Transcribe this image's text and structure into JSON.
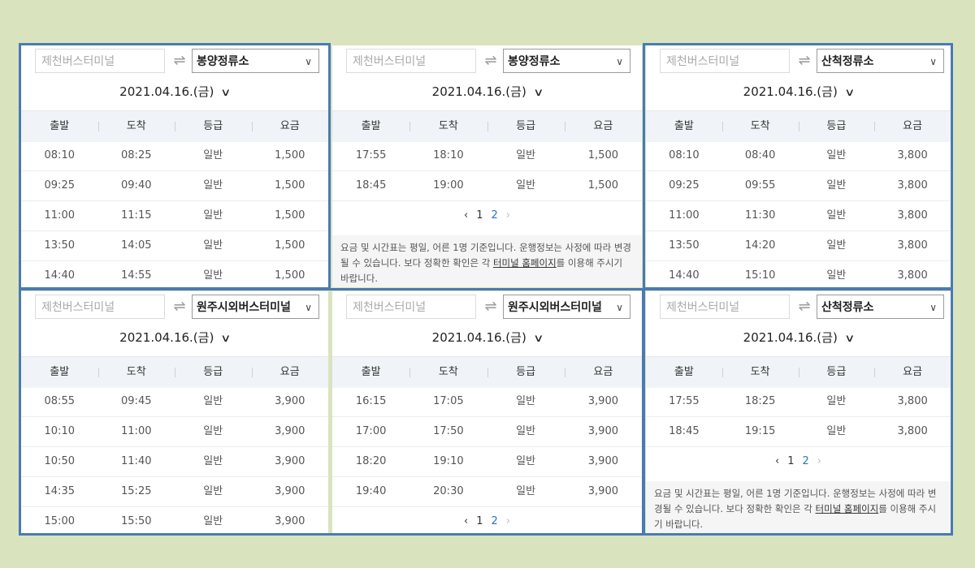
{
  "headers": [
    "출발",
    "도착",
    "등급",
    "요금"
  ],
  "panels": [
    {
      "origin_placeholder": "제천버스터미널",
      "destination": "봉양정류소",
      "date": "2021.04.16.(금)",
      "rows": [
        [
          "08:10",
          "08:25",
          "일반",
          "1,500"
        ],
        [
          "09:25",
          "09:40",
          "일반",
          "1,500"
        ],
        [
          "11:00",
          "11:15",
          "일반",
          "1,500"
        ],
        [
          "13:50",
          "14:05",
          "일반",
          "1,500"
        ],
        [
          "14:40",
          "14:55",
          "일반",
          "1,500"
        ]
      ]
    },
    {
      "origin_placeholder": "제천버스터미널",
      "destination": "봉양정류소",
      "date": "2021.04.16.(금)",
      "rows": [
        [
          "17:55",
          "18:10",
          "일반",
          "1,500"
        ],
        [
          "18:45",
          "19:00",
          "일반",
          "1,500"
        ]
      ],
      "pager": {
        "prev": "‹",
        "p1": "1",
        "p2": "2",
        "next": "›"
      },
      "notice_a": "요금 및 시간표는 평일, 어른 1명 기준입니다. 운행정보는 사정에 따라 변경될 수 있습니다. 보다 정확한 확인은 각 ",
      "notice_link": "터미널 홈페이지",
      "notice_b": "를 이용해 주시기 바랍니다."
    },
    {
      "origin_placeholder": "제천버스터미널",
      "destination": "산척정류소",
      "date": "2021.04.16.(금)",
      "rows": [
        [
          "08:10",
          "08:40",
          "일반",
          "3,800"
        ],
        [
          "09:25",
          "09:55",
          "일반",
          "3,800"
        ],
        [
          "11:00",
          "11:30",
          "일반",
          "3,800"
        ],
        [
          "13:50",
          "14:20",
          "일반",
          "3,800"
        ],
        [
          "14:40",
          "15:10",
          "일반",
          "3,800"
        ]
      ]
    },
    {
      "origin_placeholder": "제천버스터미널",
      "destination": "원주시외버스터미널",
      "date": "2021.04.16.(금)",
      "rows": [
        [
          "08:55",
          "09:45",
          "일반",
          "3,900"
        ],
        [
          "10:10",
          "11:00",
          "일반",
          "3,900"
        ],
        [
          "10:50",
          "11:40",
          "일반",
          "3,900"
        ],
        [
          "14:35",
          "15:25",
          "일반",
          "3,900"
        ],
        [
          "15:00",
          "15:50",
          "일반",
          "3,900"
        ]
      ]
    },
    {
      "origin_placeholder": "제천버스터미널",
      "destination": "원주시외버스터미널",
      "date": "2021.04.16.(금)",
      "rows": [
        [
          "16:15",
          "17:05",
          "일반",
          "3,900"
        ],
        [
          "17:00",
          "17:50",
          "일반",
          "3,900"
        ],
        [
          "18:20",
          "19:10",
          "일반",
          "3,900"
        ],
        [
          "19:40",
          "20:30",
          "일반",
          "3,900"
        ]
      ],
      "pager": {
        "prev": "‹",
        "p1": "1",
        "p2": "2",
        "next": "›"
      }
    },
    {
      "origin_placeholder": "제천버스터미널",
      "destination": "산척정류소",
      "date": "2021.04.16.(금)",
      "rows": [
        [
          "17:55",
          "18:25",
          "일반",
          "3,800"
        ],
        [
          "18:45",
          "19:15",
          "일반",
          "3,800"
        ]
      ],
      "pager": {
        "prev": "‹",
        "p1": "1",
        "p2": "2",
        "next": "›"
      },
      "notice_a": "요금 및 시간표는 평일, 어른 1명 기준입니다. 운행정보는 사정에 따라 변경될 수 있습니다. 보다 정확한 확인은 각 ",
      "notice_link": "터미널 홈페이지",
      "notice_b": "를 이용해 주시기 바랍니다."
    }
  ],
  "icons": {
    "swap": "swap-arrows-icon",
    "dropdown": "chevron-down-icon"
  },
  "colors": {
    "background": "#d9e4bf",
    "frame": "#4a7ab5",
    "table_header": "#f0f4f8",
    "current_page": "#2a72c8"
  }
}
